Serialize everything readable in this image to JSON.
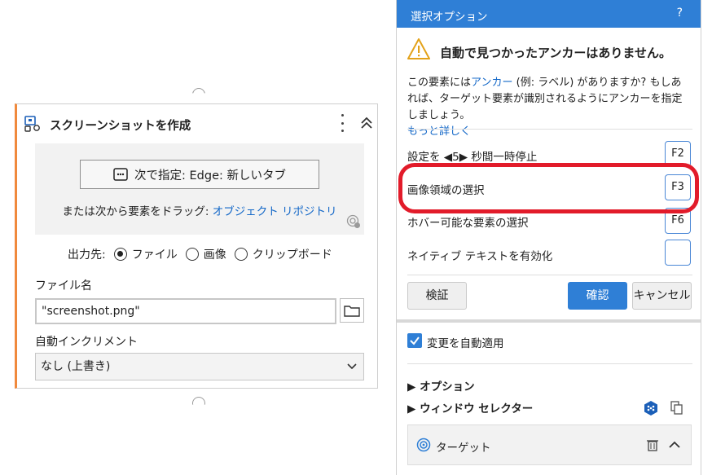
{
  "card": {
    "title": "スクリーンショットを作成",
    "select_button_label": "次で指定:  Edge: 新しいタブ",
    "drag_hint_prefix": "または次から要素をドラッグ: ",
    "drag_hint_link": "オブジェクト リポジトリ",
    "output_label": "出力先:",
    "output_options": [
      "ファイル",
      "画像",
      "クリップボード"
    ],
    "output_selected": "ファイル",
    "filename_label": "ファイル名",
    "filename_value": "\"screenshot.png\"",
    "autoincrement_label": "自動インクリメント",
    "autoincrement_value": "なし (上書き)"
  },
  "panel": {
    "title": "選択オプション",
    "help": "?",
    "warning_title": "自動で見つかったアンカーはありません。",
    "warning_body_prefix": "この要素には",
    "warning_body_link": "アンカー",
    "warning_body_rest": " (例: ラベル) がありますか? もしあれば、ターゲット要素が識別されるようにアンカーを指定しましょう。",
    "learn_more": "もっと詳しく",
    "options": [
      {
        "label": "設定を ◀5▶ 秒間一時停止",
        "key": "F2"
      },
      {
        "label": "画像領域の選択",
        "key": "F3"
      },
      {
        "label": "ホバー可能な要素の選択",
        "key": "F6"
      },
      {
        "label": "ネイティブ テキストを有効化",
        "key": ""
      }
    ],
    "validate_label": "検証",
    "confirm_label": "確認",
    "cancel_label": "キャンセル",
    "auto_apply_label": "変更を自動適用",
    "options_section": "▶ オプション",
    "window_selector_section": "▶ ウィンドウ セレクター",
    "target_label": "ターゲット"
  },
  "colors": {
    "accent": "#2f7fd6",
    "card_accent": "#f0893c",
    "highlight": "#e21b2a",
    "link": "#1468c8"
  }
}
